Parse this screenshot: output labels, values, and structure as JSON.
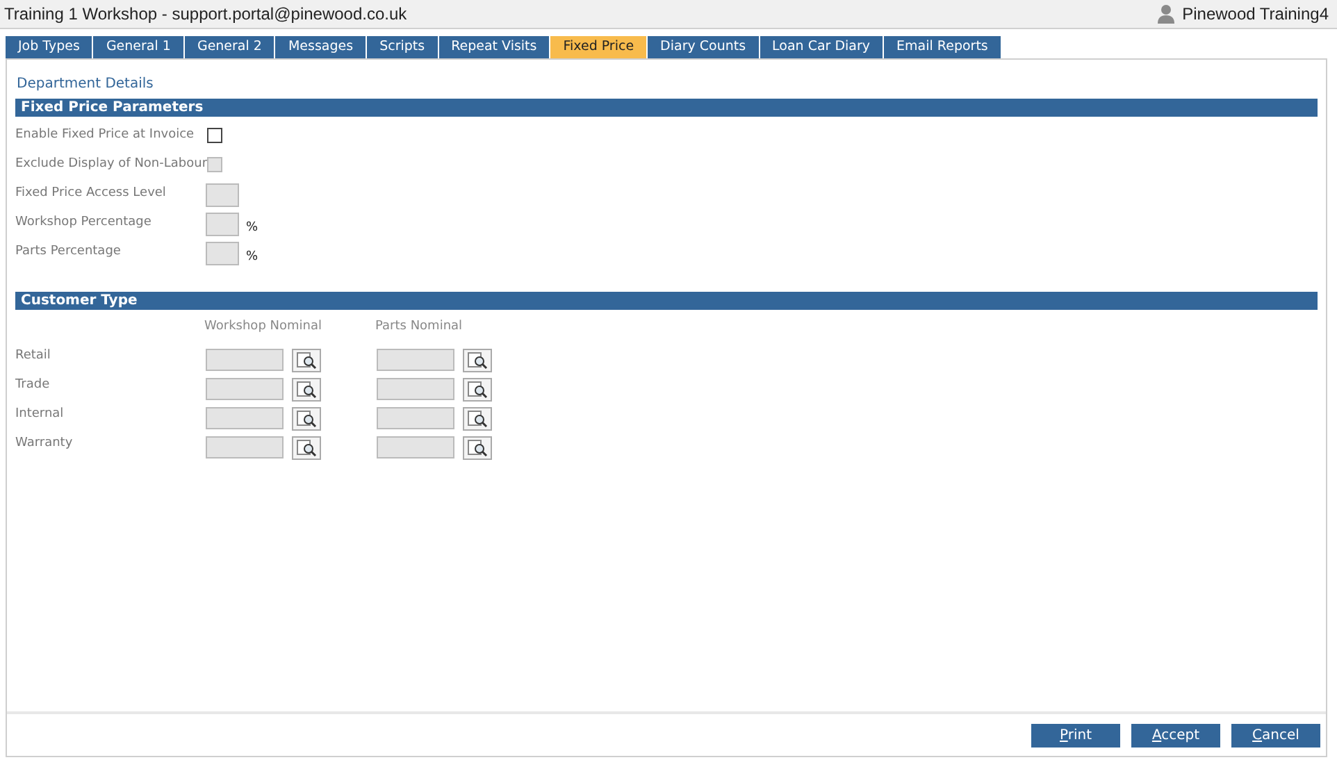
{
  "window": {
    "title": "Training 1 Workshop - support.portal@pinewood.co.uk",
    "user": "Pinewood Training4"
  },
  "tabs": [
    {
      "label": "Job Types",
      "selected": false
    },
    {
      "label": "General 1",
      "selected": false
    },
    {
      "label": "General 2",
      "selected": false
    },
    {
      "label": "Messages",
      "selected": false
    },
    {
      "label": "Scripts",
      "selected": false
    },
    {
      "label": "Repeat Visits",
      "selected": false
    },
    {
      "label": "Fixed Price",
      "selected": true
    },
    {
      "label": "Diary Counts",
      "selected": false
    },
    {
      "label": "Loan Car Diary",
      "selected": false
    },
    {
      "label": "Email Reports",
      "selected": false
    }
  ],
  "breadcrumb": "Department Details",
  "fixed_price_parameters": {
    "title": "Fixed Price Parameters",
    "fields": [
      {
        "label": "Enable Fixed Price at Invoice",
        "kind": "checkbox",
        "checked": false,
        "disabled": false
      },
      {
        "label": "Exclude Display of Non-Labour",
        "kind": "checkbox",
        "checked": false,
        "disabled": true
      },
      {
        "label": "Fixed Price Access Level",
        "kind": "input"
      },
      {
        "label": "Workshop Percentage",
        "kind": "input",
        "suffix": "%"
      },
      {
        "label": "Parts Percentage",
        "kind": "input",
        "suffix": "%"
      }
    ]
  },
  "customer_type": {
    "title": "Customer Type",
    "columns": [
      "Workshop Nominal",
      "Parts Nominal"
    ],
    "rows": [
      {
        "label": "Retail"
      },
      {
        "label": "Trade"
      },
      {
        "label": "Internal"
      },
      {
        "label": "Warranty"
      }
    ]
  },
  "buttons": [
    "Print",
    "Accept",
    "Cancel"
  ]
}
